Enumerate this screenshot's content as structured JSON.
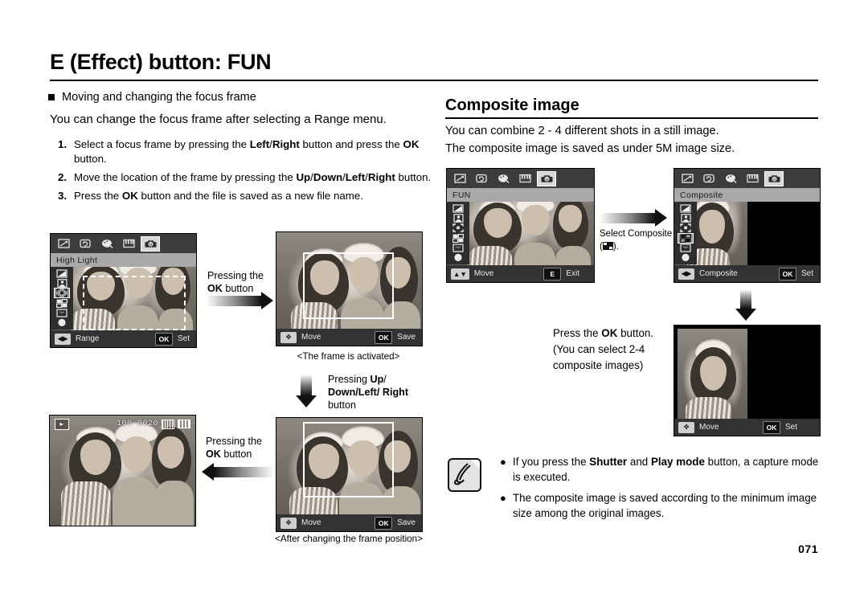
{
  "document": {
    "title": "E (Effect) button: FUN",
    "page_number": "071"
  },
  "left_column": {
    "section_bullet": "Moving and changing the focus frame",
    "intro": "You can change the focus frame after selecting a Range menu.",
    "steps": [
      {
        "num": "1.",
        "parts": [
          {
            "t": "Select a focus frame by pressing the ",
            "b": false
          },
          {
            "t": "Left",
            "b": true
          },
          {
            "t": "/",
            "b": false
          },
          {
            "t": "Right",
            "b": true
          },
          {
            "t": " button and press the ",
            "b": false
          },
          {
            "t": "OK",
            "b": true
          },
          {
            "t": " button.",
            "b": false
          }
        ]
      },
      {
        "num": "2.",
        "parts": [
          {
            "t": "Move the location of the frame by pressing the ",
            "b": false
          },
          {
            "t": "Up",
            "b": true
          },
          {
            "t": "/",
            "b": false
          },
          {
            "t": "Down",
            "b": true
          },
          {
            "t": "/",
            "b": false
          },
          {
            "t": "Left",
            "b": true
          },
          {
            "t": "/",
            "b": false
          },
          {
            "t": "Right",
            "b": true
          },
          {
            "t": " button.",
            "b": false
          }
        ]
      },
      {
        "num": "3.",
        "parts": [
          {
            "t": "Press the ",
            "b": false
          },
          {
            "t": "OK",
            "b": true
          },
          {
            "t": " button and the file is saved as a new file name.",
            "b": false
          }
        ]
      }
    ],
    "captions": {
      "pressing_ok_1_line1": "Pressing the",
      "pressing_ok_1_line2_bold": "OK",
      "pressing_ok_1_line2_rest": " button",
      "frame_activated": "<The frame is activated>",
      "pressing_updown_line1_rest": "Pressing ",
      "pressing_updown_line1_bold": "Up",
      "pressing_updown_line2_bold": "Down/Left/ Right",
      "pressing_updown_line3": "button",
      "pressing_ok_2_line1": "Pressing the",
      "pressing_ok_2_line2_bold": "OK",
      "pressing_ok_2_line2_rest": " button",
      "after_changing": "<After changing the frame position>"
    }
  },
  "right_column": {
    "title": "Composite image",
    "intro_line1": "You can combine 2 - 4 different shots in a still image.",
    "intro_line2": "The composite image is saved as under 5M image size.",
    "select_composite_line1": "Select Composite",
    "select_composite_line2_suffix": ").",
    "press_ok_line1_pre": "Press the ",
    "press_ok_line1_bold": "OK",
    "press_ok_line1_post": " button.",
    "press_ok_line2": "(You can select 2-4",
    "press_ok_line3": "composite images)",
    "notes": [
      {
        "bullet": "●",
        "parts": [
          {
            "t": "If you press the ",
            "b": false
          },
          {
            "t": "Shutter",
            "b": true
          },
          {
            "t": " and ",
            "b": false
          },
          {
            "t": "Play mode",
            "b": true
          },
          {
            "t": " button, a capture mode is executed.",
            "b": false
          }
        ]
      },
      {
        "bullet": "●",
        "parts": [
          {
            "t": "The composite image is saved according to the minimum image size among the original images.",
            "b": false
          }
        ]
      }
    ]
  },
  "lcd_screens": {
    "highlight": {
      "mode_label": "High Light",
      "tab_icons": [
        "resize-icon",
        "rotate-icon",
        "palette-icon",
        "piano-icon",
        "smiley-icon"
      ],
      "selected_tab_index": 4,
      "side_icons": [
        "brightness-icon",
        "portrait-icon",
        "focus-frame-icon",
        "composite-icon",
        "sticker-icon",
        "stamp-icon"
      ],
      "selected_side_index": 2,
      "bottom_left_key": "◀▶",
      "bottom_left_label": "Range",
      "bottom_right_key": "OK",
      "bottom_right_label": "Set"
    },
    "frame_activated": {
      "bottom_left_key": "✥",
      "bottom_left_label": "Move",
      "bottom_right_key": "OK",
      "bottom_right_label": "Save"
    },
    "frame_moved": {
      "bottom_left_key": "✥",
      "bottom_left_label": "Move",
      "bottom_right_key": "OK",
      "bottom_right_label": "Save"
    },
    "playback": {
      "play_icon": "▶",
      "file_number": "100-0020",
      "card_icon": "memory-card-icon",
      "battery_icon": "battery-icon"
    },
    "fun": {
      "mode_label": "FUN",
      "tab_icons": [
        "resize-icon",
        "rotate-icon",
        "palette-icon",
        "piano-icon",
        "smiley-icon"
      ],
      "selected_tab_index": 4,
      "side_icons": [
        "brightness-icon",
        "portrait-icon",
        "focus-frame-icon",
        "composite-icon",
        "sticker-icon",
        "stamp-icon"
      ],
      "bottom_left_key": "▲▼",
      "bottom_left_label": "Move",
      "bottom_right_key": "E",
      "bottom_right_label": "Exit"
    },
    "composite": {
      "mode_label": "Composite",
      "tab_icons": [
        "resize-icon",
        "rotate-icon",
        "palette-icon",
        "piano-icon",
        "smiley-icon"
      ],
      "selected_tab_index": 4,
      "side_icons": [
        "brightness-icon",
        "portrait-icon",
        "focus-frame-icon",
        "composite-icon",
        "sticker-icon",
        "stamp-icon"
      ],
      "selected_side_index": 3,
      "bottom_left_key": "◀▶",
      "bottom_left_label": "Composite",
      "bottom_right_key": "OK",
      "bottom_right_label": "Set"
    },
    "composite_select": {
      "bottom_left_key": "✥",
      "bottom_left_label": "Move",
      "bottom_right_key": "OK",
      "bottom_right_label": "Set"
    }
  },
  "colors": {
    "lcd_bar": "#333333",
    "lcd_mode_bar": "#a9a9a9",
    "text": "#000000",
    "page_bg": "#ffffff"
  }
}
